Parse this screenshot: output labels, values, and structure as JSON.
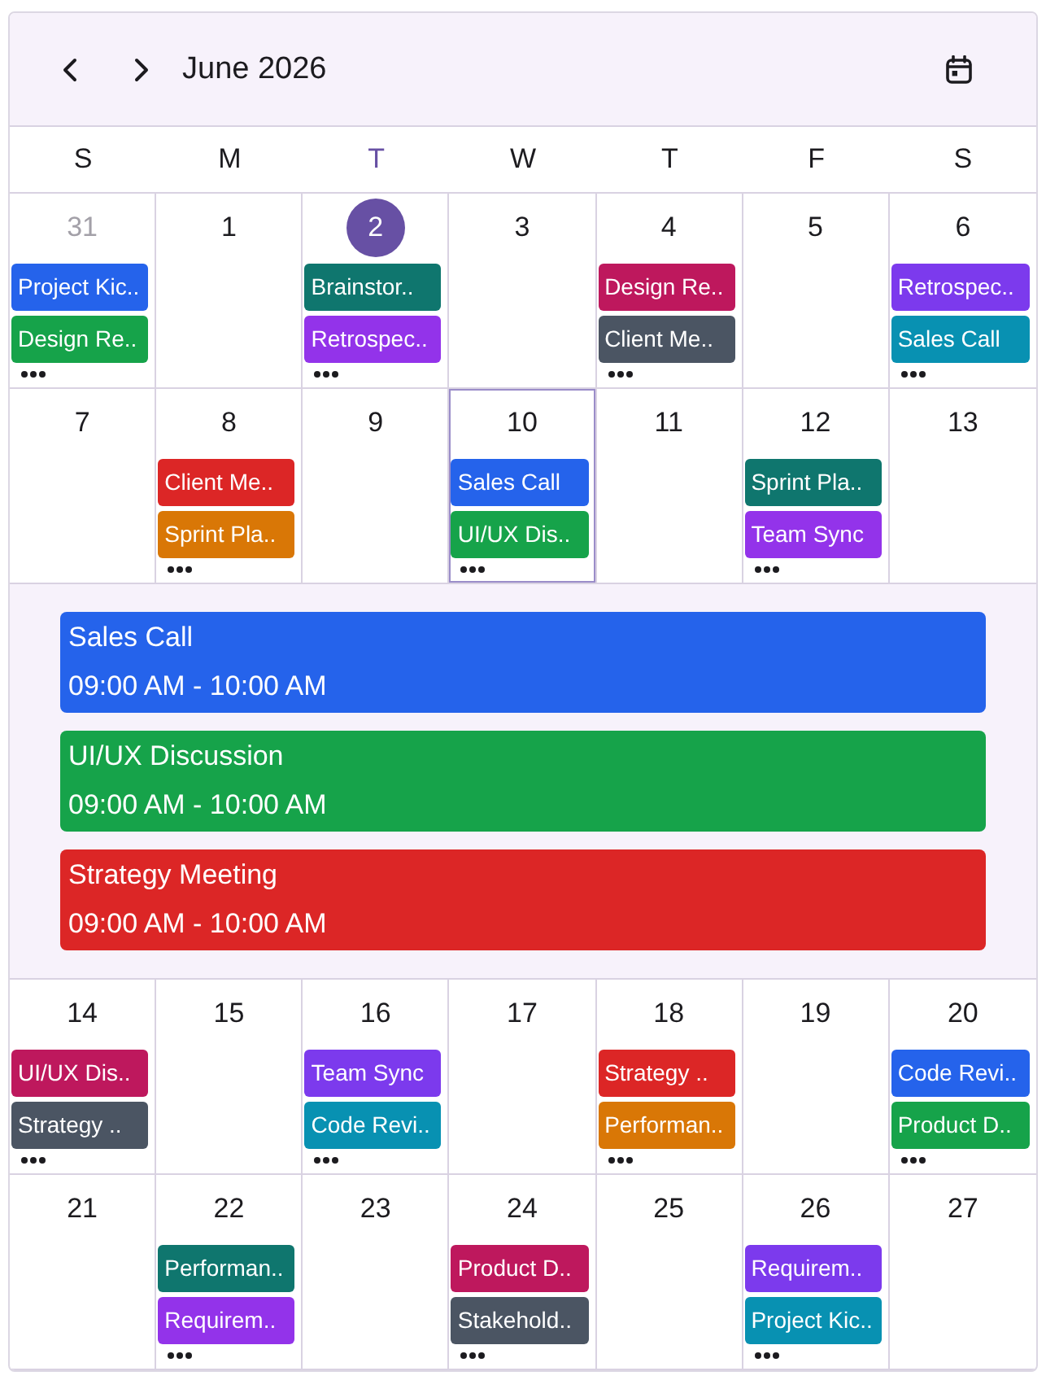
{
  "header": {
    "title": "June 2026"
  },
  "weekdays": [
    {
      "label": "S",
      "today": false
    },
    {
      "label": "M",
      "today": false
    },
    {
      "label": "T",
      "today": true
    },
    {
      "label": "W",
      "today": false
    },
    {
      "label": "T",
      "today": false
    },
    {
      "label": "F",
      "today": false
    },
    {
      "label": "S",
      "today": false
    }
  ],
  "weeks": [
    {
      "days": [
        {
          "date": "31",
          "other_month": true,
          "today": false,
          "selected": false,
          "more": true,
          "events": [
            {
              "title": "Project Kic..",
              "color": "#2563eb"
            },
            {
              "title": "Design Re..",
              "color": "#16a34a"
            }
          ]
        },
        {
          "date": "1",
          "other_month": false,
          "today": false,
          "selected": false,
          "more": false
        },
        {
          "date": "2",
          "other_month": false,
          "today": true,
          "selected": false,
          "more": true,
          "events": [
            {
              "title": "Brainstor..",
              "color": "#0f766e"
            },
            {
              "title": "Retrospec..",
              "color": "#9333ea"
            }
          ]
        },
        {
          "date": "3",
          "other_month": false,
          "today": false,
          "selected": false,
          "more": false
        },
        {
          "date": "4",
          "other_month": false,
          "today": false,
          "selected": false,
          "more": true,
          "events": [
            {
              "title": "Design Re..",
              "color": "#be185d"
            },
            {
              "title": "Client Me..",
              "color": "#4b5563"
            }
          ]
        },
        {
          "date": "5",
          "other_month": false,
          "today": false,
          "selected": false,
          "more": false
        },
        {
          "date": "6",
          "other_month": false,
          "today": false,
          "selected": false,
          "more": true,
          "events": [
            {
              "title": "Retrospec..",
              "color": "#7c3aed"
            },
            {
              "title": "Sales Call",
              "color": "#0891b2"
            }
          ]
        }
      ]
    },
    {
      "days": [
        {
          "date": "7",
          "other_month": false,
          "today": false,
          "selected": false,
          "more": false
        },
        {
          "date": "8",
          "other_month": false,
          "today": false,
          "selected": false,
          "more": true,
          "events": [
            {
              "title": "Client Me..",
              "color": "#dc2626"
            },
            {
              "title": "Sprint Pla..",
              "color": "#d97706"
            }
          ]
        },
        {
          "date": "9",
          "other_month": false,
          "today": false,
          "selected": false,
          "more": false
        },
        {
          "date": "10",
          "other_month": false,
          "today": false,
          "selected": true,
          "more": true,
          "events": [
            {
              "title": "Sales Call",
              "color": "#2563eb"
            },
            {
              "title": "UI/UX Dis..",
              "color": "#16a34a"
            }
          ]
        },
        {
          "date": "11",
          "other_month": false,
          "today": false,
          "selected": false,
          "more": false
        },
        {
          "date": "12",
          "other_month": false,
          "today": false,
          "selected": false,
          "more": true,
          "events": [
            {
              "title": "Sprint Pla..",
              "color": "#0f766e"
            },
            {
              "title": "Team Sync",
              "color": "#9333ea"
            }
          ]
        },
        {
          "date": "13",
          "other_month": false,
          "today": false,
          "selected": false,
          "more": false
        }
      ],
      "agenda": [
        {
          "title": "Sales Call",
          "time": "09:00 AM - 10:00 AM",
          "color": "#2563eb"
        },
        {
          "title": "UI/UX Discussion",
          "time": "09:00 AM - 10:00 AM",
          "color": "#16a34a"
        },
        {
          "title": "Strategy Meeting",
          "time": "09:00 AM - 10:00 AM",
          "color": "#dc2626"
        }
      ]
    },
    {
      "days": [
        {
          "date": "14",
          "other_month": false,
          "today": false,
          "selected": false,
          "more": true,
          "events": [
            {
              "title": "UI/UX Dis..",
              "color": "#be185d"
            },
            {
              "title": "Strategy ..",
              "color": "#4b5563"
            }
          ]
        },
        {
          "date": "15",
          "other_month": false,
          "today": false,
          "selected": false,
          "more": false
        },
        {
          "date": "16",
          "other_month": false,
          "today": false,
          "selected": false,
          "more": true,
          "events": [
            {
              "title": "Team Sync",
              "color": "#7c3aed"
            },
            {
              "title": "Code Revi..",
              "color": "#0891b2"
            }
          ]
        },
        {
          "date": "17",
          "other_month": false,
          "today": false,
          "selected": false,
          "more": false
        },
        {
          "date": "18",
          "other_month": false,
          "today": false,
          "selected": false,
          "more": true,
          "events": [
            {
              "title": "Strategy ..",
              "color": "#dc2626"
            },
            {
              "title": "Performan..",
              "color": "#d97706"
            }
          ]
        },
        {
          "date": "19",
          "other_month": false,
          "today": false,
          "selected": false,
          "more": false
        },
        {
          "date": "20",
          "other_month": false,
          "today": false,
          "selected": false,
          "more": true,
          "events": [
            {
              "title": "Code Revi..",
              "color": "#2563eb"
            },
            {
              "title": "Product D..",
              "color": "#16a34a"
            }
          ]
        }
      ]
    },
    {
      "days": [
        {
          "date": "21",
          "other_month": false,
          "today": false,
          "selected": false,
          "more": false
        },
        {
          "date": "22",
          "other_month": false,
          "today": false,
          "selected": false,
          "more": true,
          "events": [
            {
              "title": "Performan..",
              "color": "#0f766e"
            },
            {
              "title": "Requirem..",
              "color": "#9333ea"
            }
          ]
        },
        {
          "date": "23",
          "other_month": false,
          "today": false,
          "selected": false,
          "more": false
        },
        {
          "date": "24",
          "other_month": false,
          "today": false,
          "selected": false,
          "more": true,
          "events": [
            {
              "title": "Product D..",
              "color": "#be185d"
            },
            {
              "title": "Stakehold..",
              "color": "#4b5563"
            }
          ]
        },
        {
          "date": "25",
          "other_month": false,
          "today": false,
          "selected": false,
          "more": false
        },
        {
          "date": "26",
          "other_month": false,
          "today": false,
          "selected": false,
          "more": true,
          "events": [
            {
              "title": "Requirem..",
              "color": "#7c3aed"
            },
            {
              "title": "Project Kic..",
              "color": "#0891b2"
            }
          ]
        },
        {
          "date": "27",
          "other_month": false,
          "today": false,
          "selected": false,
          "more": false
        }
      ]
    }
  ]
}
